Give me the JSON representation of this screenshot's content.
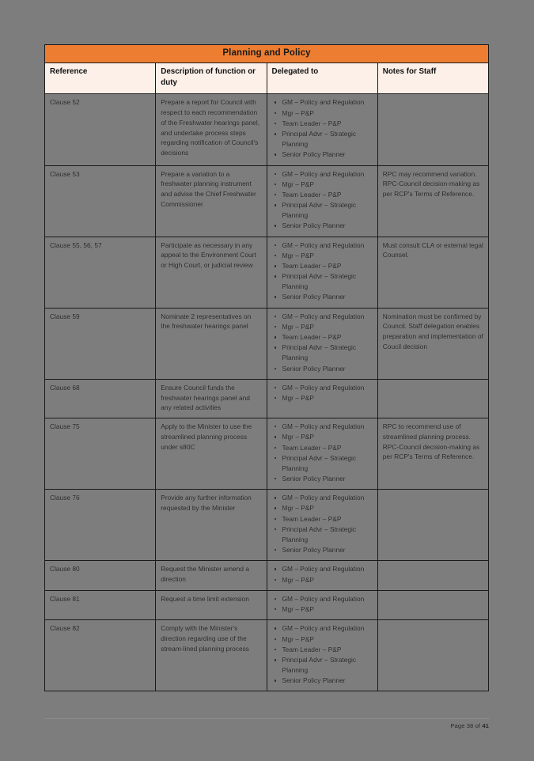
{
  "document": {
    "table_title": "Planning and Policy",
    "columns": [
      "Reference",
      "Description of function or duty",
      "Delegated to",
      "Notes for Staff"
    ],
    "footer": {
      "prefix": "Page 38 of ",
      "bold": "41"
    },
    "colors": {
      "title_bar": "#ED7D31",
      "header_row": "#FCF0E9",
      "page_background": "#7d7d7d",
      "border": "#1a1a1a"
    },
    "rows": [
      {
        "reference": "Clause 52",
        "description": "Prepare a report for Council with respect to each recommendation of the Freshwater hearings panel, and undertake process steps regarding notification of Council's decisions",
        "delegated_to": [
          "GM – Policy and Regulation",
          "Mgr – P&P",
          "Team Leader – P&P",
          "Principal Advr – Strategic Planning",
          "Senior Policy Planner"
        ],
        "notes": ""
      },
      {
        "reference": "Clause 53",
        "description": "Prepare a variation to a freshwater planning instrument and advise the Chief Freshwater Commissioner",
        "delegated_to": [
          "GM – Policy and Regulation",
          "Mgr – P&P",
          "Team Leader – P&P",
          "Principal Advr – Strategic Planning",
          "Senior Policy Planner"
        ],
        "notes": "RPC may recommend variation. RPC-Council decision-making as per RCP's Terms of Reference."
      },
      {
        "reference": "Clause 55, 56, 57",
        "description": "Participate as necessary in any appeal to the Environment Court or High Court, or judicial review",
        "delegated_to": [
          "GM – Policy and Regulation",
          "Mgr – P&P",
          "Team Leader – P&P",
          "Principal Advr – Strategic Planning",
          "Senior Policy Planner"
        ],
        "notes": "Must consult CLA or external legal Counsel."
      },
      {
        "reference": "Clause 59",
        "description": "Nominate 2 representatives on the freshwater hearings panel",
        "delegated_to": [
          "GM – Policy and Regulation",
          "Mgr – P&P",
          "Team Leader – P&P",
          "Principal Advr – Strategic Planning",
          "Senior Policy Planner"
        ],
        "notes": "Nomination must be confirmed by Council. Staff delegation enables preparation and implementation of Coucil decision"
      },
      {
        "reference": "Clause 68",
        "description": "Ensure Council funds the freshwater hearings panel and any related activities",
        "delegated_to": [
          "GM – Policy and Regulation",
          "Mgr – P&P"
        ],
        "notes": ""
      },
      {
        "reference": "Clause 75",
        "description": "Apply to the Minister to use the streamlined planning process under s80C",
        "delegated_to": [
          "GM – Policy and Regulation",
          "Mgr – P&P",
          "Team Leader – P&P",
          "Principal Advr – Strategic Planning",
          "Senior Policy Planner"
        ],
        "notes": "RPC to recommend use of streamlined planning process. RPC-Council decision-making as per RCP's Terms of Reference."
      },
      {
        "reference": "Clause 76",
        "description": "Provide any further information requested by the Minister",
        "delegated_to": [
          "GM – Policy and Regulation",
          "Mgr – P&P",
          "Team Leader – P&P",
          "Principal Advr – Strategic Planning",
          "Senior Policy Planner"
        ],
        "notes": ""
      },
      {
        "reference": "Clause 80",
        "description": "Request the Minister amend a direction",
        "delegated_to": [
          "GM – Policy and Regulation",
          "Mgr – P&P"
        ],
        "notes": ""
      },
      {
        "reference": "Clause 81",
        "description": "Request a time limit extension",
        "delegated_to": [
          "GM – Policy and Regulation",
          "Mgr – P&P"
        ],
        "notes": ""
      },
      {
        "reference": "Clause 82",
        "description": "Comply with the Minister's direction regarding use of the stream-lined planning process",
        "delegated_to": [
          "GM – Policy and Regulation",
          "Mgr – P&P",
          "Team Leader – P&P",
          "Principal Advr – Strategic Planning",
          "Senior Policy Planner"
        ],
        "notes": ""
      }
    ]
  }
}
